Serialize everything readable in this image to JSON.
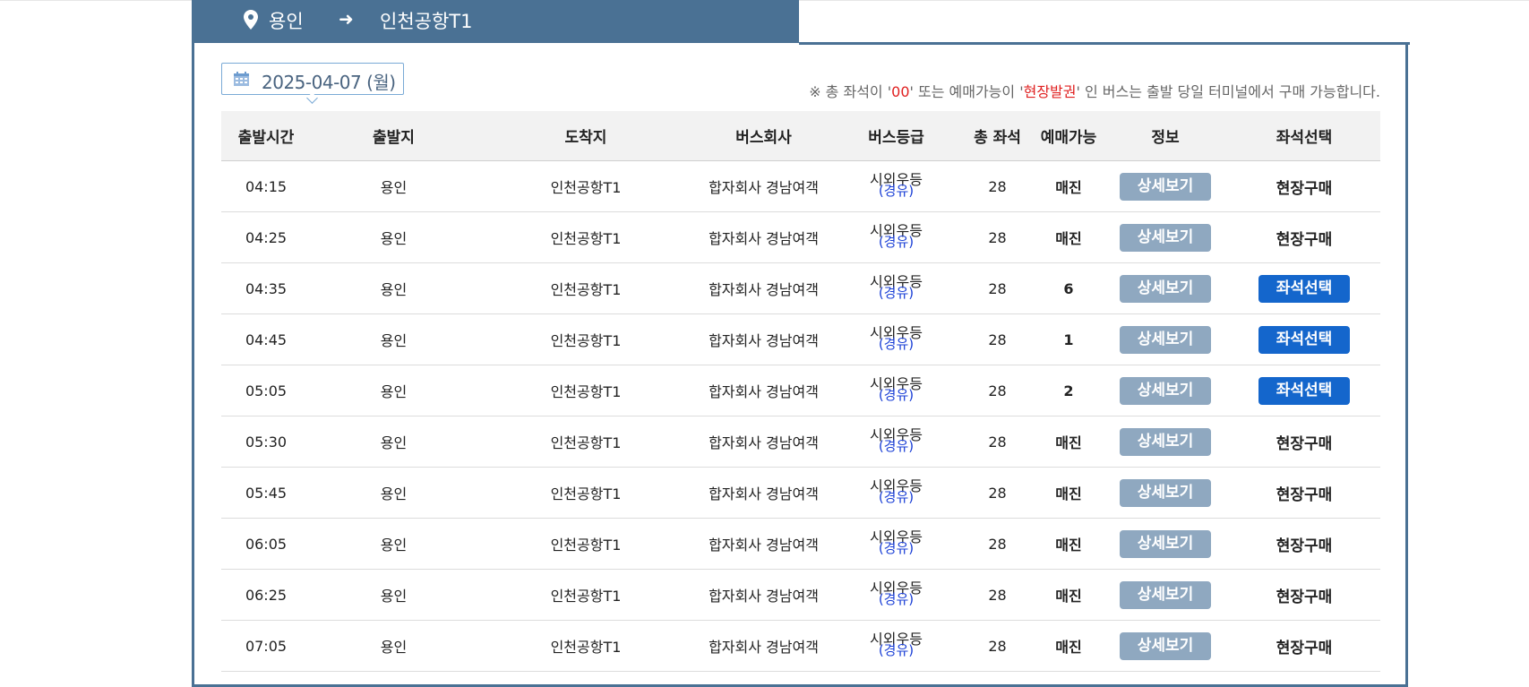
{
  "route": {
    "from": "용인",
    "to": "인천공항T1"
  },
  "date": "2025-04-07 (월)",
  "notice": {
    "prefix": "※ 총 좌석이 '",
    "zero": "00",
    "middle": "' 또는 예매가능이 '",
    "onsite": "현장발권",
    "suffix": "' 인 버스는 출발 당일 터미널에서 구매 가능합니다."
  },
  "columns": [
    "출발시간",
    "출발지",
    "도착지",
    "버스회사",
    "버스등급",
    "총 좌석",
    "예매가능",
    "정보",
    "좌석선택"
  ],
  "detail_label": "상세보기",
  "rows": [
    {
      "time": "04:15",
      "from": "용인",
      "to": "인천공항T1",
      "company": "합자회사 경남여객",
      "grade": "시외우등",
      "grade_sub": "(경유)",
      "seats": "28",
      "avail": "매진",
      "select": "현장구매",
      "selectable": false
    },
    {
      "time": "04:25",
      "from": "용인",
      "to": "인천공항T1",
      "company": "합자회사 경남여객",
      "grade": "시외우등",
      "grade_sub": "(경유)",
      "seats": "28",
      "avail": "매진",
      "select": "현장구매",
      "selectable": false
    },
    {
      "time": "04:35",
      "from": "용인",
      "to": "인천공항T1",
      "company": "합자회사 경남여객",
      "grade": "시외우등",
      "grade_sub": "(경유)",
      "seats": "28",
      "avail": "6",
      "select": "좌석선택",
      "selectable": true
    },
    {
      "time": "04:45",
      "from": "용인",
      "to": "인천공항T1",
      "company": "합자회사 경남여객",
      "grade": "시외우등",
      "grade_sub": "(경유)",
      "seats": "28",
      "avail": "1",
      "select": "좌석선택",
      "selectable": true
    },
    {
      "time": "05:05",
      "from": "용인",
      "to": "인천공항T1",
      "company": "합자회사 경남여객",
      "grade": "시외우등",
      "grade_sub": "(경유)",
      "seats": "28",
      "avail": "2",
      "select": "좌석선택",
      "selectable": true
    },
    {
      "time": "05:30",
      "from": "용인",
      "to": "인천공항T1",
      "company": "합자회사 경남여객",
      "grade": "시외우등",
      "grade_sub": "(경유)",
      "seats": "28",
      "avail": "매진",
      "select": "현장구매",
      "selectable": false
    },
    {
      "time": "05:45",
      "from": "용인",
      "to": "인천공항T1",
      "company": "합자회사 경남여객",
      "grade": "시외우등",
      "grade_sub": "(경유)",
      "seats": "28",
      "avail": "매진",
      "select": "현장구매",
      "selectable": false
    },
    {
      "time": "06:05",
      "from": "용인",
      "to": "인천공항T1",
      "company": "합자회사 경남여객",
      "grade": "시외우등",
      "grade_sub": "(경유)",
      "seats": "28",
      "avail": "매진",
      "select": "현장구매",
      "selectable": false
    },
    {
      "time": "06:25",
      "from": "용인",
      "to": "인천공항T1",
      "company": "합자회사 경남여객",
      "grade": "시외우등",
      "grade_sub": "(경유)",
      "seats": "28",
      "avail": "매진",
      "select": "현장구매",
      "selectable": false
    },
    {
      "time": "07:05",
      "from": "용인",
      "to": "인천공항T1",
      "company": "합자회사 경남여객",
      "grade": "시외우등",
      "grade_sub": "(경유)",
      "seats": "28",
      "avail": "매진",
      "select": "현장구매",
      "selectable": false
    }
  ],
  "colors": {
    "header_bg": "#4a7194",
    "detail_btn": "#8fa8c0",
    "seat_btn": "#1466cc",
    "notice_red": "#e02020",
    "grade_sub": "#1a3fd6"
  },
  "icons": {
    "route_from": "map-pin-icon",
    "route_arrow": "arrow-right-icon",
    "date": "calendar-icon"
  }
}
